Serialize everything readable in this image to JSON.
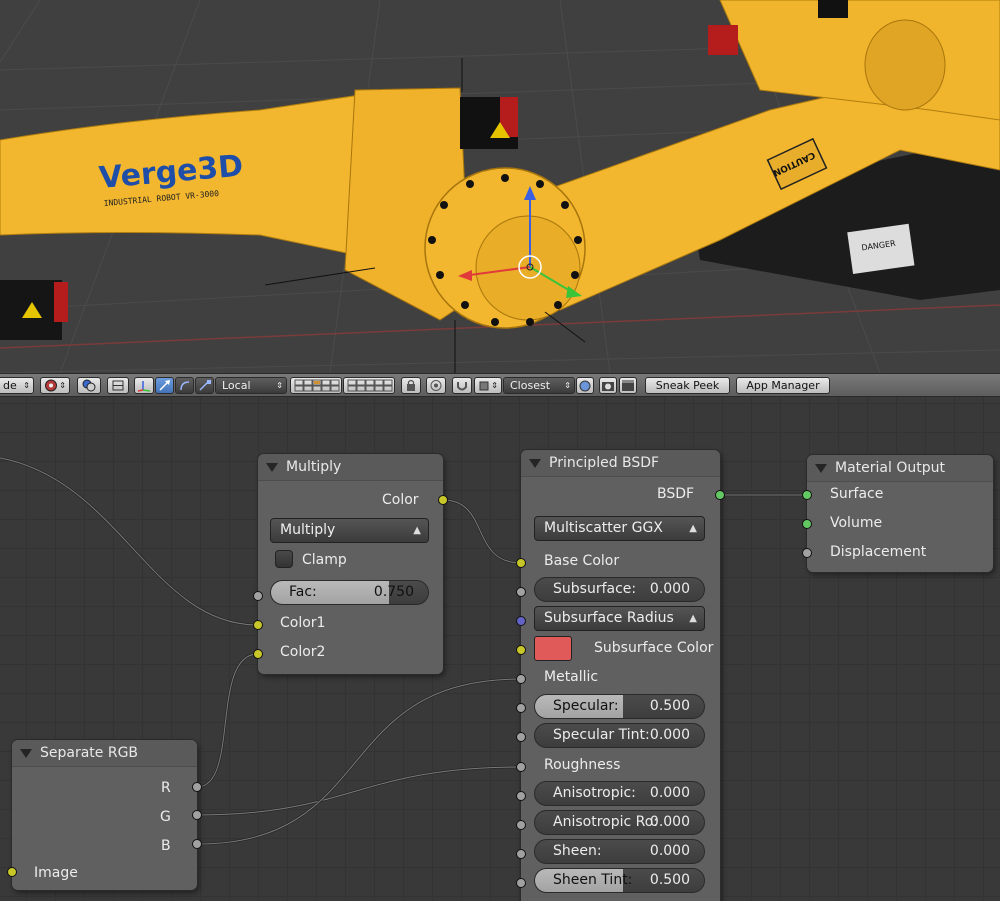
{
  "viewport": {
    "logo_text": "Verge3D",
    "logo_subtext": "INDUSTRIAL ROBOT VR-3000",
    "caution_text": "CAUTION",
    "sticker_text": "DANGER"
  },
  "toolbar": {
    "mode_label": "de",
    "orientation_label": "Local",
    "snap_label": "Closest",
    "sneak_peek_label": "Sneak Peek",
    "app_manager_label": "App Manager",
    "dropdown_arrow": "⇕"
  },
  "nodes": {
    "multiply": {
      "title": "Multiply",
      "output_color": "Color",
      "blend_type": "Multiply",
      "clamp_label": "Clamp",
      "fac_label": "Fac:",
      "fac_value": "0.750",
      "fac_fraction": 0.75,
      "input1": "Color1",
      "input2": "Color2"
    },
    "principled": {
      "title": "Principled BSDF",
      "output": "BSDF",
      "distribution": "Multiscatter GGX",
      "base_color": "Base Color",
      "subsurface_label": "Subsurface:",
      "subsurface_value": "0.000",
      "subsurface_radius": "Subsurface Radius",
      "subsurface_color_label": "Subsurface Color",
      "subsurface_color": "#e05a5a",
      "metallic": "Metallic",
      "specular_label": "Specular:",
      "specular_value": "0.500",
      "specular_tint_label": "Specular Tint:",
      "specular_tint_value": "0.000",
      "roughness": "Roughness",
      "anisotropic_label": "Anisotropic:",
      "anisotropic_value": "0.000",
      "anisotropic_rot_label": "Anisotropic Ro:",
      "anisotropic_rot_value": "0.000",
      "sheen_label": "Sheen:",
      "sheen_value": "0.000",
      "sheen_tint_label": "Sheen Tint:",
      "sheen_tint_value": "0.500"
    },
    "output": {
      "title": "Material Output",
      "surface": "Surface",
      "volume": "Volume",
      "displacement": "Displacement"
    },
    "separate": {
      "title": "Separate RGB",
      "r": "R",
      "g": "G",
      "b": "B",
      "image": "Image"
    }
  },
  "colors": {
    "socket_color": "#c7c729",
    "socket_float": "#a1a1a1",
    "socket_shader": "#63c763",
    "socket_vector": "#6363c7",
    "robot_yellow": "#f2b72e"
  }
}
